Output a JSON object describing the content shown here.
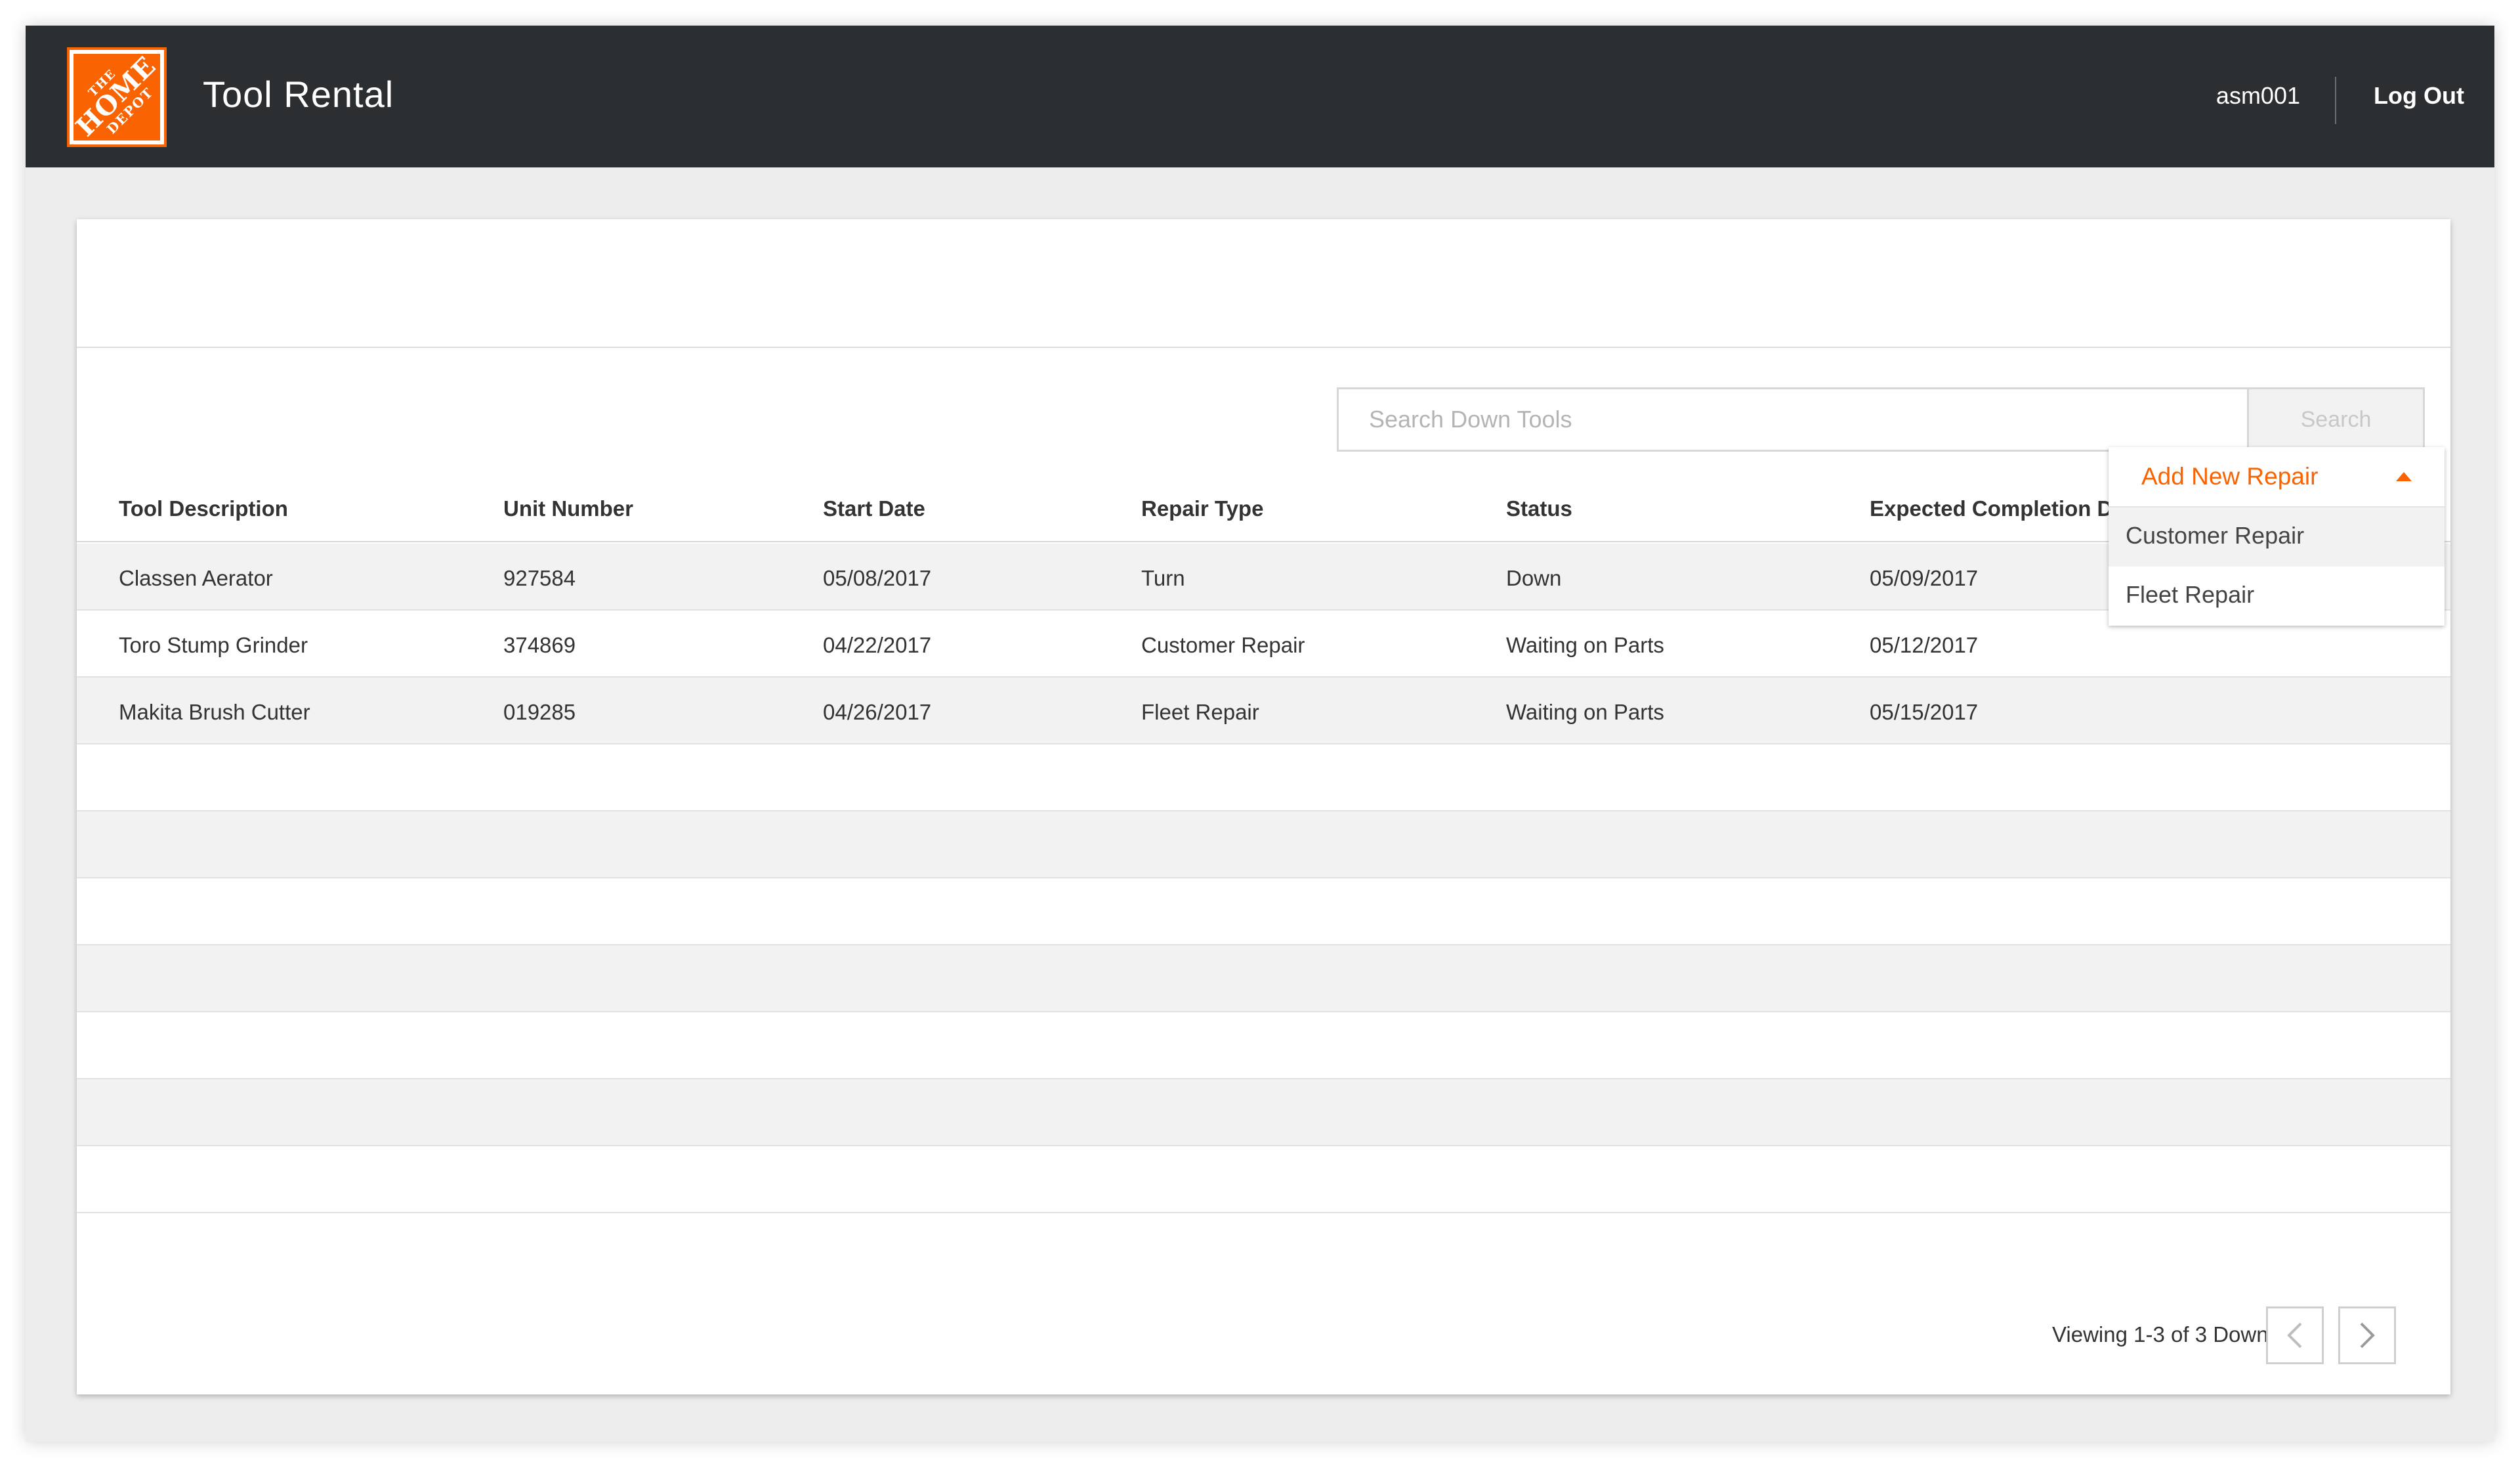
{
  "header": {
    "logo_text": [
      "THE",
      "HOME",
      "DEPOT"
    ],
    "title": "Tool Rental",
    "username": "asm001",
    "logout_label": "Log Out"
  },
  "repair_menu": {
    "label": "Add New Repair",
    "options": [
      "Customer Repair",
      "Fleet Repair"
    ]
  },
  "search": {
    "placeholder": "Search Down Tools",
    "button_label": "Search"
  },
  "table": {
    "columns": [
      "Tool Description",
      "Unit Number",
      "Start Date",
      "Repair Type",
      "Status",
      "Expected Completion Date"
    ],
    "rows": [
      [
        "Classen Aerator",
        "927584",
        "05/08/2017",
        "Turn",
        "Down",
        "05/09/2017"
      ],
      [
        "Toro Stump Grinder",
        "374869",
        "04/22/2017",
        "Customer Repair",
        "Waiting on Parts",
        "05/12/2017"
      ],
      [
        "Makita Brush Cutter",
        "019285",
        "04/26/2017",
        "Fleet Repair",
        "Waiting on Parts",
        "05/15/2017"
      ]
    ]
  },
  "pagination": {
    "summary": "Viewing 1-3 of 3 Down Tools"
  },
  "colors": {
    "brand_orange": "#f96302",
    "topbar": "#2c2f31",
    "row_shade": "#f2f2f2"
  }
}
